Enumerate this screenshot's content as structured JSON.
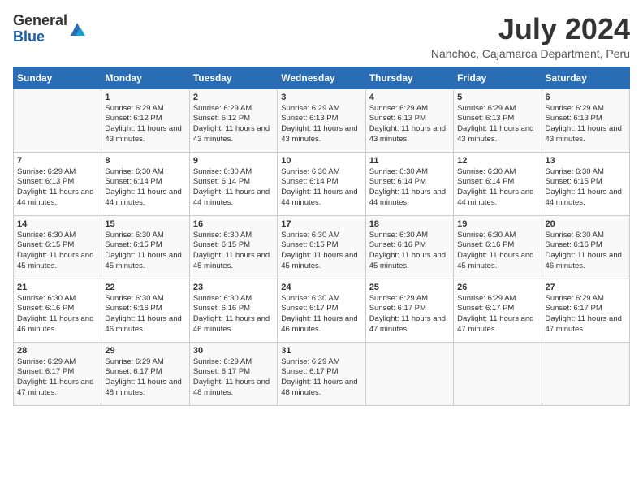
{
  "logo": {
    "general": "General",
    "blue": "Blue"
  },
  "title": "July 2024",
  "location": "Nanchoc, Cajamarca Department, Peru",
  "days_header": [
    "Sunday",
    "Monday",
    "Tuesday",
    "Wednesday",
    "Thursday",
    "Friday",
    "Saturday"
  ],
  "weeks": [
    [
      {
        "day": "",
        "sunrise": "",
        "sunset": "",
        "daylight": ""
      },
      {
        "day": "1",
        "sunrise": "Sunrise: 6:29 AM",
        "sunset": "Sunset: 6:12 PM",
        "daylight": "Daylight: 11 hours and 43 minutes."
      },
      {
        "day": "2",
        "sunrise": "Sunrise: 6:29 AM",
        "sunset": "Sunset: 6:12 PM",
        "daylight": "Daylight: 11 hours and 43 minutes."
      },
      {
        "day": "3",
        "sunrise": "Sunrise: 6:29 AM",
        "sunset": "Sunset: 6:13 PM",
        "daylight": "Daylight: 11 hours and 43 minutes."
      },
      {
        "day": "4",
        "sunrise": "Sunrise: 6:29 AM",
        "sunset": "Sunset: 6:13 PM",
        "daylight": "Daylight: 11 hours and 43 minutes."
      },
      {
        "day": "5",
        "sunrise": "Sunrise: 6:29 AM",
        "sunset": "Sunset: 6:13 PM",
        "daylight": "Daylight: 11 hours and 43 minutes."
      },
      {
        "day": "6",
        "sunrise": "Sunrise: 6:29 AM",
        "sunset": "Sunset: 6:13 PM",
        "daylight": "Daylight: 11 hours and 43 minutes."
      }
    ],
    [
      {
        "day": "7",
        "sunrise": "Sunrise: 6:29 AM",
        "sunset": "Sunset: 6:13 PM",
        "daylight": "Daylight: 11 hours and 44 minutes."
      },
      {
        "day": "8",
        "sunrise": "Sunrise: 6:30 AM",
        "sunset": "Sunset: 6:14 PM",
        "daylight": "Daylight: 11 hours and 44 minutes."
      },
      {
        "day": "9",
        "sunrise": "Sunrise: 6:30 AM",
        "sunset": "Sunset: 6:14 PM",
        "daylight": "Daylight: 11 hours and 44 minutes."
      },
      {
        "day": "10",
        "sunrise": "Sunrise: 6:30 AM",
        "sunset": "Sunset: 6:14 PM",
        "daylight": "Daylight: 11 hours and 44 minutes."
      },
      {
        "day": "11",
        "sunrise": "Sunrise: 6:30 AM",
        "sunset": "Sunset: 6:14 PM",
        "daylight": "Daylight: 11 hours and 44 minutes."
      },
      {
        "day": "12",
        "sunrise": "Sunrise: 6:30 AM",
        "sunset": "Sunset: 6:14 PM",
        "daylight": "Daylight: 11 hours and 44 minutes."
      },
      {
        "day": "13",
        "sunrise": "Sunrise: 6:30 AM",
        "sunset": "Sunset: 6:15 PM",
        "daylight": "Daylight: 11 hours and 44 minutes."
      }
    ],
    [
      {
        "day": "14",
        "sunrise": "Sunrise: 6:30 AM",
        "sunset": "Sunset: 6:15 PM",
        "daylight": "Daylight: 11 hours and 45 minutes."
      },
      {
        "day": "15",
        "sunrise": "Sunrise: 6:30 AM",
        "sunset": "Sunset: 6:15 PM",
        "daylight": "Daylight: 11 hours and 45 minutes."
      },
      {
        "day": "16",
        "sunrise": "Sunrise: 6:30 AM",
        "sunset": "Sunset: 6:15 PM",
        "daylight": "Daylight: 11 hours and 45 minutes."
      },
      {
        "day": "17",
        "sunrise": "Sunrise: 6:30 AM",
        "sunset": "Sunset: 6:15 PM",
        "daylight": "Daylight: 11 hours and 45 minutes."
      },
      {
        "day": "18",
        "sunrise": "Sunrise: 6:30 AM",
        "sunset": "Sunset: 6:16 PM",
        "daylight": "Daylight: 11 hours and 45 minutes."
      },
      {
        "day": "19",
        "sunrise": "Sunrise: 6:30 AM",
        "sunset": "Sunset: 6:16 PM",
        "daylight": "Daylight: 11 hours and 45 minutes."
      },
      {
        "day": "20",
        "sunrise": "Sunrise: 6:30 AM",
        "sunset": "Sunset: 6:16 PM",
        "daylight": "Daylight: 11 hours and 46 minutes."
      }
    ],
    [
      {
        "day": "21",
        "sunrise": "Sunrise: 6:30 AM",
        "sunset": "Sunset: 6:16 PM",
        "daylight": "Daylight: 11 hours and 46 minutes."
      },
      {
        "day": "22",
        "sunrise": "Sunrise: 6:30 AM",
        "sunset": "Sunset: 6:16 PM",
        "daylight": "Daylight: 11 hours and 46 minutes."
      },
      {
        "day": "23",
        "sunrise": "Sunrise: 6:30 AM",
        "sunset": "Sunset: 6:16 PM",
        "daylight": "Daylight: 11 hours and 46 minutes."
      },
      {
        "day": "24",
        "sunrise": "Sunrise: 6:30 AM",
        "sunset": "Sunset: 6:17 PM",
        "daylight": "Daylight: 11 hours and 46 minutes."
      },
      {
        "day": "25",
        "sunrise": "Sunrise: 6:29 AM",
        "sunset": "Sunset: 6:17 PM",
        "daylight": "Daylight: 11 hours and 47 minutes."
      },
      {
        "day": "26",
        "sunrise": "Sunrise: 6:29 AM",
        "sunset": "Sunset: 6:17 PM",
        "daylight": "Daylight: 11 hours and 47 minutes."
      },
      {
        "day": "27",
        "sunrise": "Sunrise: 6:29 AM",
        "sunset": "Sunset: 6:17 PM",
        "daylight": "Daylight: 11 hours and 47 minutes."
      }
    ],
    [
      {
        "day": "28",
        "sunrise": "Sunrise: 6:29 AM",
        "sunset": "Sunset: 6:17 PM",
        "daylight": "Daylight: 11 hours and 47 minutes."
      },
      {
        "day": "29",
        "sunrise": "Sunrise: 6:29 AM",
        "sunset": "Sunset: 6:17 PM",
        "daylight": "Daylight: 11 hours and 48 minutes."
      },
      {
        "day": "30",
        "sunrise": "Sunrise: 6:29 AM",
        "sunset": "Sunset: 6:17 PM",
        "daylight": "Daylight: 11 hours and 48 minutes."
      },
      {
        "day": "31",
        "sunrise": "Sunrise: 6:29 AM",
        "sunset": "Sunset: 6:17 PM",
        "daylight": "Daylight: 11 hours and 48 minutes."
      },
      {
        "day": "",
        "sunrise": "",
        "sunset": "",
        "daylight": ""
      },
      {
        "day": "",
        "sunrise": "",
        "sunset": "",
        "daylight": ""
      },
      {
        "day": "",
        "sunrise": "",
        "sunset": "",
        "daylight": ""
      }
    ]
  ]
}
